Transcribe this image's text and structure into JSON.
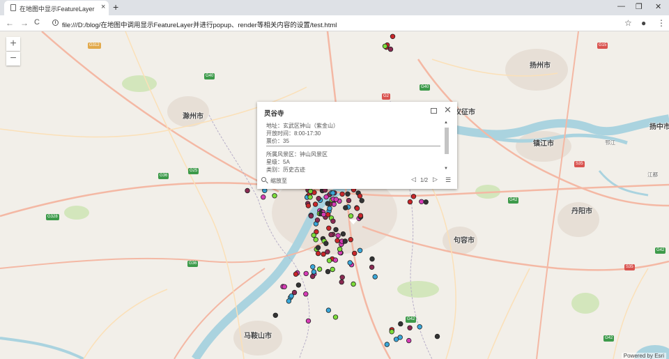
{
  "browser": {
    "tab_title": "在地图中显示FeatureLayer",
    "tab_close": "×",
    "new_tab": "+",
    "window_minimize": "—",
    "window_restore": "❐",
    "window_close": "✕",
    "nav_back": "←",
    "nav_forward": "→",
    "nav_reload": "C",
    "address": "file:///D:/blog/在地图中调用显示FeatureLayer并进行popup、render等相关内容的设置/test.html",
    "bookmark": "☆",
    "account": "●",
    "menu": "⋮"
  },
  "map": {
    "zoom_in": "+",
    "zoom_out": "−",
    "attribution": "Powered by Esri",
    "colors": {
      "water": "#aad3df",
      "land": "#f2efe9",
      "park": "#cfe3b7",
      "road_major": "#f4b8a4",
      "road_minor": "#fbe0b8",
      "urban": "#e8e0d8"
    },
    "cities": [
      {
        "name": "扬州市",
        "size": "big"
      },
      {
        "name": "滁州市",
        "size": "big"
      },
      {
        "name": "仪征市",
        "size": "big"
      },
      {
        "name": "镇江市",
        "size": "big"
      },
      {
        "name": "扬中市",
        "size": "big"
      },
      {
        "name": "丹阳市",
        "size": "big"
      },
      {
        "name": "句容市",
        "size": "big"
      },
      {
        "name": "马鞍山市",
        "size": "big"
      },
      {
        "name": "邗江",
        "size": "small"
      },
      {
        "name": "江都",
        "size": "small"
      }
    ],
    "shields": [
      "G312",
      "G40",
      "G2",
      "G15",
      "G42",
      "G25",
      "G36",
      "G328",
      "S35"
    ],
    "markers": {
      "colors": [
        "#d63cb5",
        "#7ddc3b",
        "#c9262a",
        "#3aa7d9",
        "#8a2a52",
        "#333333"
      ]
    }
  },
  "popup": {
    "title": "灵谷寺",
    "dock_icon": "dock",
    "close": "✕",
    "rows": [
      "地址：玄武区钟山（紫金山）",
      "开放时间：8:00-17:30",
      "票价：35",
      "所属风景区：钟山风景区",
      "星级：5A",
      "类别：历史古迹"
    ],
    "zoom_to": "缩放至",
    "pagination": "1/2",
    "prev": "◁",
    "next": "▷",
    "list": "☰",
    "scroll_up": "▲",
    "scroll_down": "▼"
  }
}
